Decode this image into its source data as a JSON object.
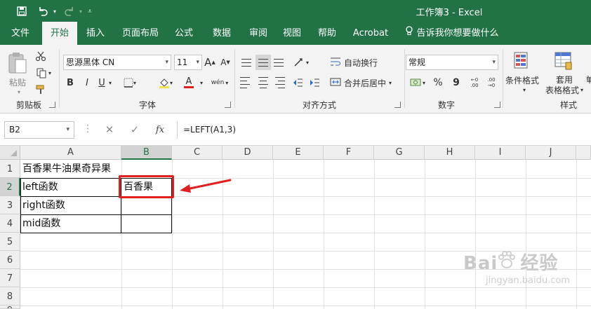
{
  "window": {
    "title": "工作簿3  -  Excel"
  },
  "quick_access": {
    "save": "save-icon",
    "undo": "undo-icon",
    "redo": "redo-icon",
    "customize": "customize-icon"
  },
  "tabs": [
    "文件",
    "开始",
    "插入",
    "页面布局",
    "公式",
    "数据",
    "审阅",
    "视图",
    "帮助",
    "Acrobat",
    "告诉我你想要做什么"
  ],
  "active_tab": "开始",
  "ribbon": {
    "clipboard": {
      "paste": "粘贴",
      "label": "剪贴板"
    },
    "font": {
      "name": "思源黑体 CN",
      "size": "11",
      "bold": "B",
      "italic": "I",
      "underline": "U",
      "grow": "A",
      "shrink": "A",
      "color": "A",
      "phonetic": "wén",
      "label": "字体"
    },
    "alignment": {
      "wrap": "自动换行",
      "merge": "合并后居中",
      "label": "对齐方式"
    },
    "number": {
      "format": "常规",
      "percent": "%",
      "comma": "9",
      "label": "数字"
    },
    "styles": {
      "conditional": "条件格式",
      "table1": "套用",
      "table2": "表格格式",
      "cell": "单",
      "label": "样式"
    }
  },
  "formula_bar": {
    "name_box": "B2",
    "cancel": "✕",
    "enter": "✓",
    "fx": "fx",
    "formula": "=LEFT(A1,3)"
  },
  "grid": {
    "columns": [
      "A",
      "B",
      "C",
      "D",
      "E",
      "F",
      "G",
      "H",
      "I",
      "J"
    ],
    "rows": [
      "1",
      "2",
      "3",
      "4",
      "5",
      "6",
      "7",
      "8",
      "9"
    ],
    "cells": {
      "A1": "百香果牛油果奇异果",
      "A2": "left函数",
      "A3": "right函数",
      "A4": "mid函数",
      "B2": "百香果"
    },
    "selected_cell": "B2"
  },
  "annotation_color": "#e02020",
  "watermark": {
    "brand": "Bai 经验",
    "url": "jingyan.baidu.com"
  }
}
